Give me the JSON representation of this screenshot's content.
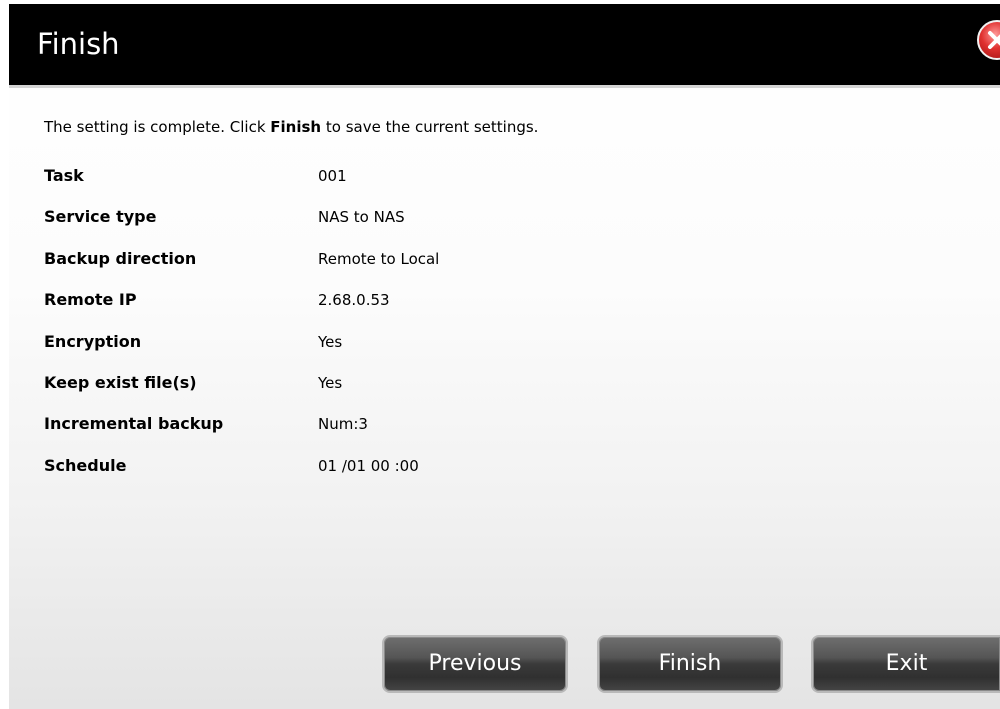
{
  "dialog": {
    "title": "Finish",
    "intro_before": "The setting is complete. Click ",
    "intro_bold": "Finish",
    "intro_after": " to save the current settings."
  },
  "summary": [
    {
      "label": "Task",
      "value": "001"
    },
    {
      "label": "Service type",
      "value": "NAS to NAS"
    },
    {
      "label": "Backup direction",
      "value": "Remote to Local"
    },
    {
      "label": "Remote IP",
      "value": "2.68.0.53"
    },
    {
      "label": "Encryption",
      "value": "Yes"
    },
    {
      "label": "Keep exist file(s)",
      "value": "Yes"
    },
    {
      "label": "Incremental backup",
      "value": "Num:3"
    },
    {
      "label": "Schedule",
      "value": "01 /01 00 :00"
    }
  ],
  "buttons": {
    "previous": "Previous",
    "finish": "Finish",
    "exit": "Exit"
  },
  "icons": {
    "close": "close-icon"
  },
  "colors": {
    "titlebar": "#000000",
    "close_accent": "#e0312f",
    "button": "#3a3a3a"
  }
}
